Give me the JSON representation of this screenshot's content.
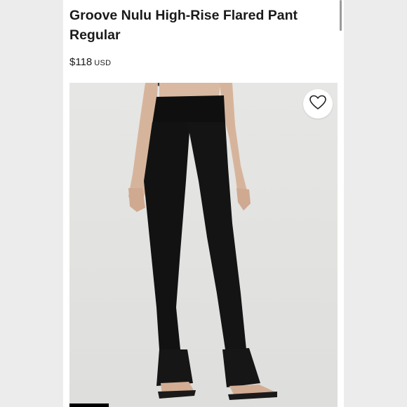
{
  "product": {
    "title_line1": "Groove Nulu High-Rise Flared Pant",
    "title_line2": "Regular",
    "price": "$118",
    "currency": "USD"
  },
  "icons": {
    "favorite": "heart-outline-icon"
  },
  "colors": {
    "text": "#1a1a1a",
    "pant": "#111111",
    "photo_bg": "#e3e3e1"
  }
}
